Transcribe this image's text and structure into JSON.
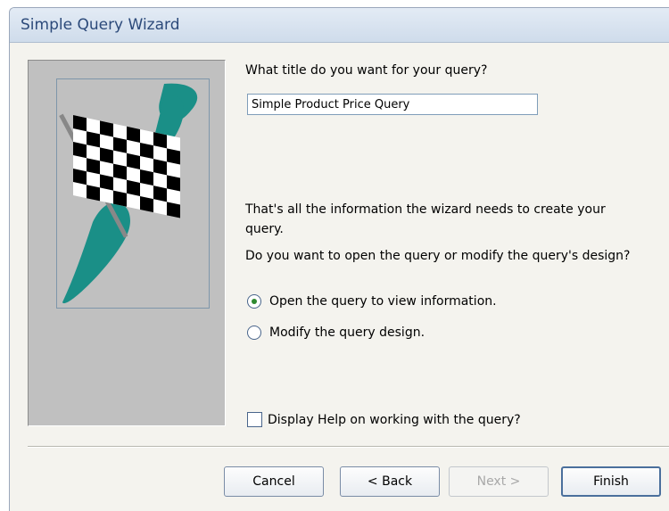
{
  "window": {
    "title": "Simple Query Wizard"
  },
  "form": {
    "title_prompt": "What title do you want for your query?",
    "title_value": "Simple Product Price Query",
    "info_line1": "That's all the information the wizard needs to create your",
    "info_line2": "query.",
    "open_or_modify": "Do you want to open the query or modify the query's design?",
    "option_open": "Open the query to view information.",
    "option_modify": "Modify the query design.",
    "selected_option": "open",
    "help_label": "Display Help on working with the query?",
    "help_checked": false
  },
  "buttons": {
    "cancel": "Cancel",
    "back": "< Back",
    "next": "Next >",
    "finish": "Finish"
  },
  "icons": {
    "illustration": "checkered-flag-icon"
  },
  "colors": {
    "flag_swoosh": "#1a8f87",
    "panel_gray": "#c0c0c0",
    "title_text": "#2c4a7a"
  }
}
